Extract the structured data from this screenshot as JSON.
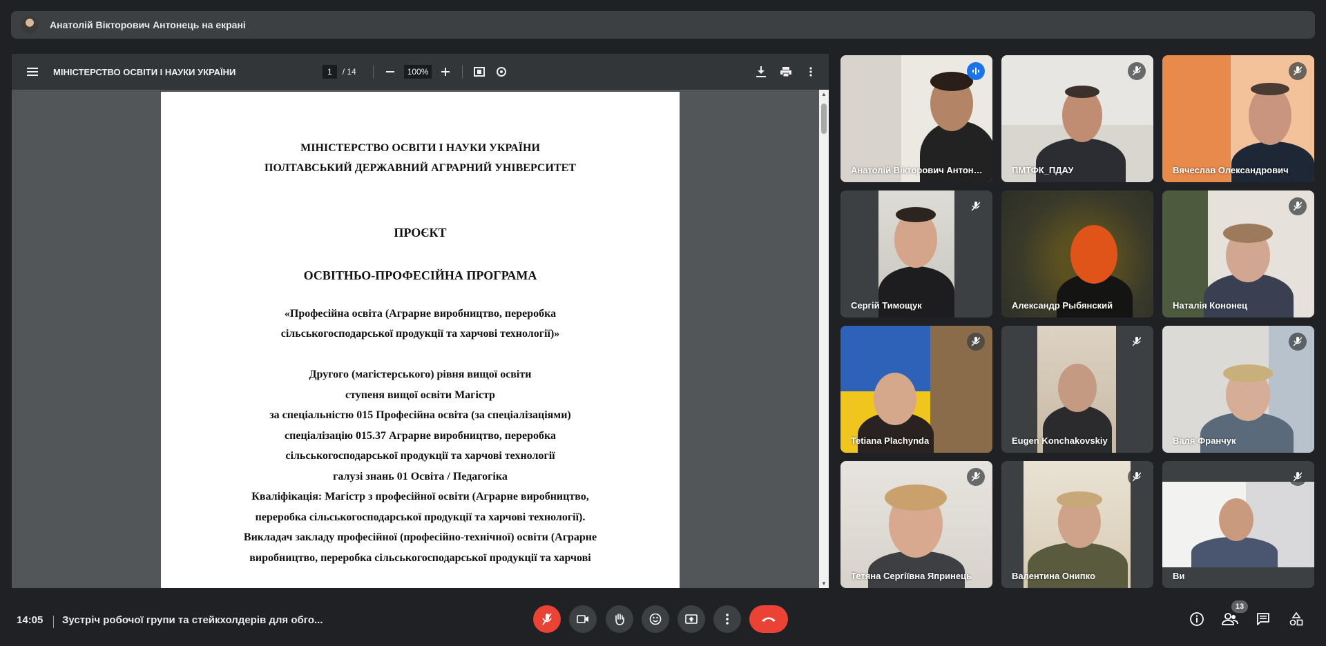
{
  "banner": {
    "presenter_text": "Анатолій Вікторович Антонець на екрані"
  },
  "pdf": {
    "title": "МІНІСТЕРСТВО ОСВІТИ І НАУКИ УКРАЇНИ",
    "page_current": "1",
    "page_total": "/ 14",
    "zoom": "100%",
    "icons": [
      "menu-icon",
      "zoom-out-icon",
      "zoom-in-icon",
      "fit-page-icon",
      "rotate-icon",
      "download-icon",
      "print-icon",
      "more-vert-icon"
    ],
    "lines": [
      "МІНІСТЕРСТВО ОСВІТИ І НАУКИ УКРАЇНИ",
      "ПОЛТАВСЬКИЙ ДЕРЖАВНИЙ АГРАРНИЙ УНІВЕРСИТЕТ",
      "ПРОЄКТ",
      "ОСВІТНЬО-ПРОФЕСІЙНА ПРОГРАМА",
      "«Професійна освіта (Аграрне виробництво, переробка",
      "сільськогосподарської продукції та харчові технології)»",
      "Другого (магістерського) рівня вищої освіти",
      "ступеня вищої освіти Магістр",
      "за спеціальністю 015 Професійна освіта (за спеціалізаціями)",
      "спеціалізацію 015.37 Аграрне виробництво, переробка",
      "сільськогосподарської продукції та харчові технології",
      "галузі знань 01 Освіта / Педагогіка",
      "Кваліфікація: Магістр з професійної освіти (Аграрне виробництво,",
      "переробка сільськогосподарської продукції та харчові технології).",
      "Викладач закладу професійної (професійно-технічної) освіти (Аграрне",
      "виробництво, переробка сільськогосподарської продукції та харчові"
    ]
  },
  "participants": [
    {
      "name": "Анатолій Вікторович Антонець",
      "mic": "speaking"
    },
    {
      "name": "ПМТФК_ПДАУ",
      "mic": "muted"
    },
    {
      "name": "Вячеслав Олександрович",
      "mic": "muted"
    },
    {
      "name": "Сергій Тимощук",
      "mic": "muted"
    },
    {
      "name": "Александр Рыбянский",
      "mic": "none"
    },
    {
      "name": "Наталія Кононец",
      "mic": "muted"
    },
    {
      "name": "Tetiana Plachynda",
      "mic": "muted"
    },
    {
      "name": "Eugen Konchakovskiy",
      "mic": "muted"
    },
    {
      "name": "Валя Франчук",
      "mic": "muted"
    },
    {
      "name": "Тетяна Сергіївна Япринець",
      "mic": "muted"
    },
    {
      "name": "Валентина Онипко",
      "mic": "muted"
    },
    {
      "name": "Ви",
      "mic": "muted"
    }
  ],
  "bottom": {
    "time": "14:05",
    "meeting_title": "Зустріч робочої групи та стейкхолдерів для обго...",
    "participants_count": "13",
    "controls": [
      "mic-off-icon",
      "camera-icon",
      "raise-hand-icon",
      "emoji-icon",
      "present-screen-icon",
      "more-options-icon",
      "end-call-icon"
    ],
    "right_icons": [
      "info-icon",
      "people-icon",
      "chat-icon",
      "activities-icon"
    ],
    "colors": {
      "danger": "#ea4335",
      "surface": "#3c4043",
      "background": "#202124",
      "speaking": "#8ab4f8"
    }
  }
}
